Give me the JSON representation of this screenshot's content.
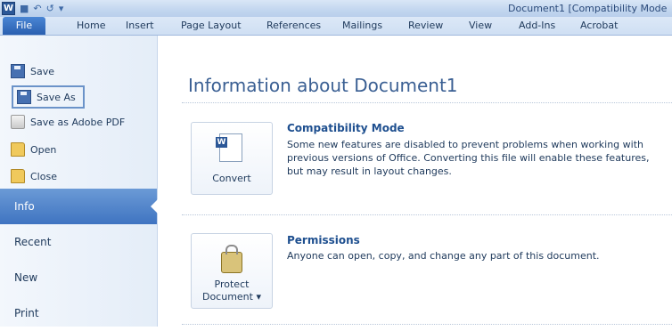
{
  "titlebar": {
    "app_logo": "W",
    "title": "Document1 [Compatibility Mode"
  },
  "ribbon_tabs": [
    "File",
    "Home",
    "Insert",
    "Page Layout",
    "References",
    "Mailings",
    "Review",
    "View",
    "Add-Ins",
    "Acrobat"
  ],
  "backstage": {
    "commands": [
      {
        "label": "Save",
        "icon": "save-icon"
      },
      {
        "label": "Save As",
        "icon": "save-as-icon"
      },
      {
        "label": "Save as Adobe PDF",
        "icon": "pdf-icon"
      },
      {
        "label": "Open",
        "icon": "open-folder-icon"
      },
      {
        "label": "Close",
        "icon": "close-folder-icon"
      }
    ],
    "sections": [
      "Info",
      "Recent",
      "New",
      "Print"
    ],
    "active_section": "Info"
  },
  "main": {
    "title": "Information about Document1",
    "compatibility": {
      "button_label": "Convert",
      "heading": "Compatibility Mode",
      "description": "Some new features are disabled to prevent problems when working with previous versions of Office. Converting this file will enable these features, but may result in layout changes."
    },
    "permissions": {
      "button_line1": "Protect",
      "button_line2": "Document ▾",
      "heading": "Permissions",
      "description": "Anyone can open, copy, and change any part of this document."
    }
  },
  "colors": {
    "accent": "#2b5797",
    "active_nav": "#3f74c1"
  }
}
